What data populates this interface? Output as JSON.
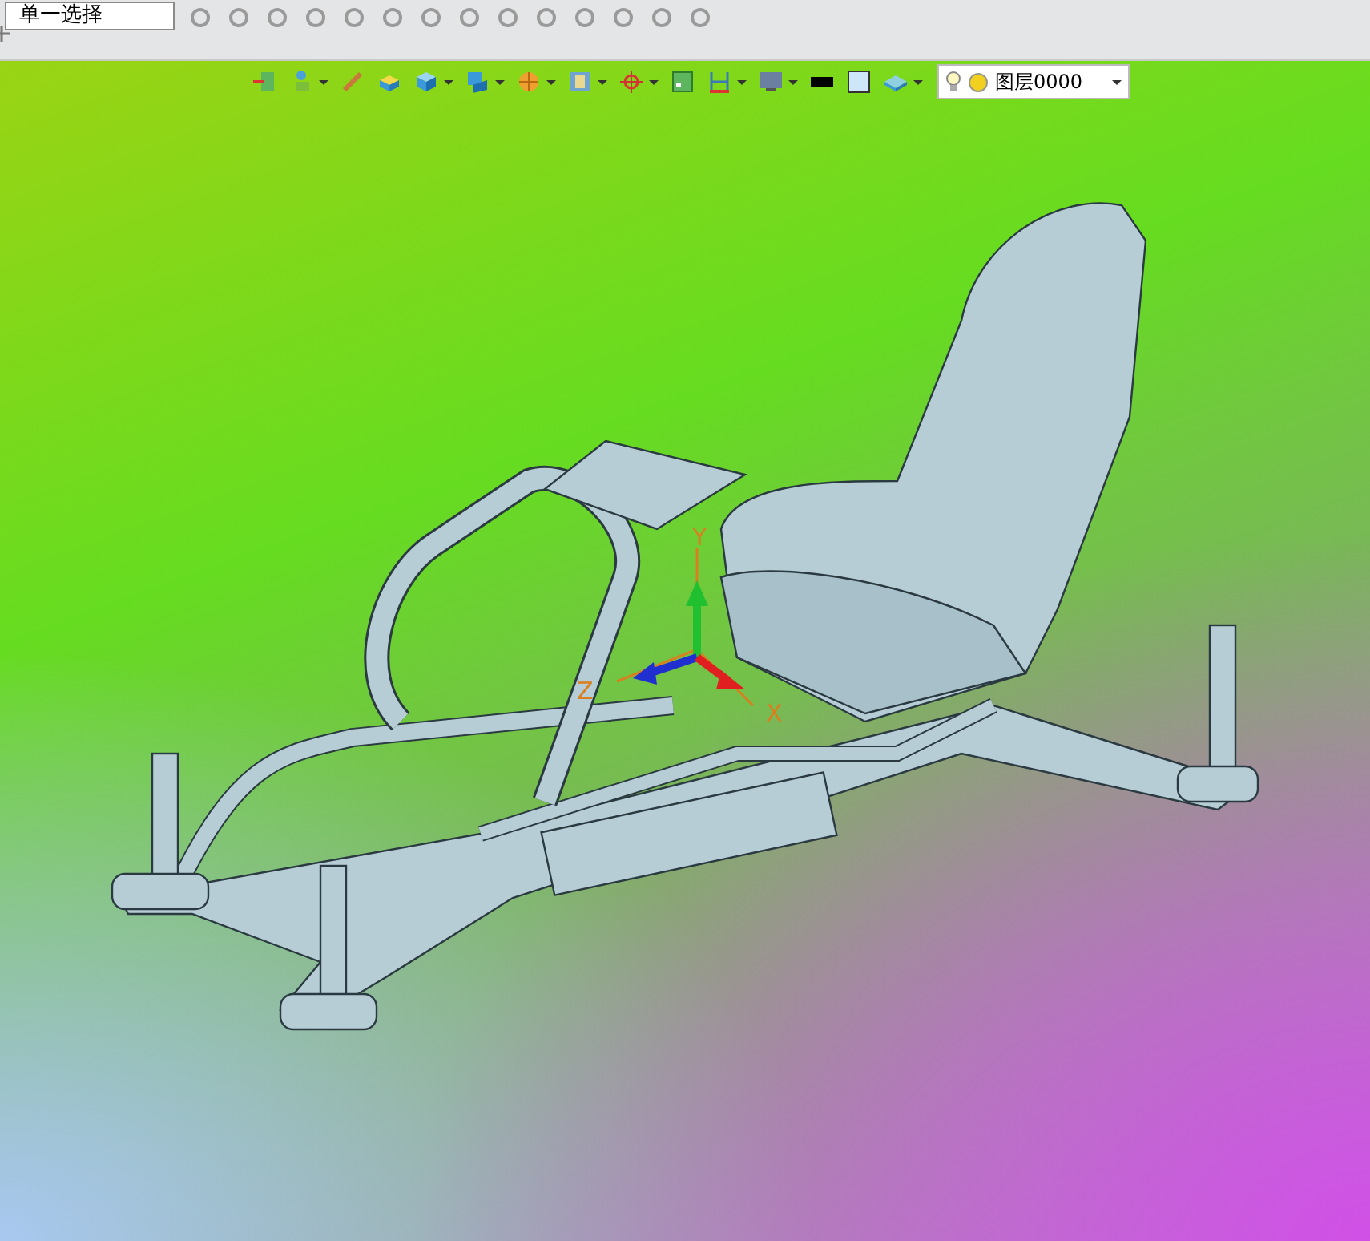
{
  "top_toolbar": {
    "selection_filter": "单一选择"
  },
  "view_toolbar": {
    "items": [
      {
        "dropdown": false
      },
      {
        "dropdown": true
      },
      {
        "dropdown": false
      },
      {
        "dropdown": false
      },
      {
        "dropdown": true
      },
      {
        "dropdown": true
      },
      {
        "dropdown": true
      },
      {
        "dropdown": true
      },
      {
        "dropdown": true
      },
      {
        "dropdown": false
      },
      {
        "dropdown": true
      },
      {
        "dropdown": true
      },
      {
        "dropdown": false
      },
      {
        "dropdown": false
      },
      {
        "dropdown": true
      }
    ],
    "layer": {
      "name": "图层0000"
    }
  },
  "triad": {
    "x_label": "X",
    "y_label": "Y",
    "z_label": "Z"
  }
}
